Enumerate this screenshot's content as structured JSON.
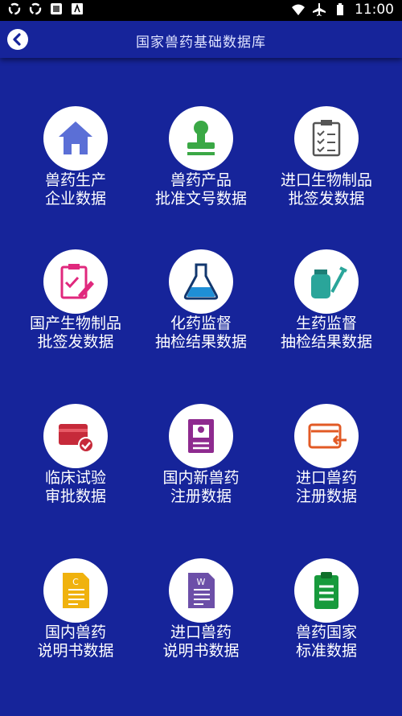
{
  "status_bar": {
    "time": "11:00",
    "left_icons": [
      "sync-icon",
      "sync-icon",
      "app-notification-icon",
      "android-icon"
    ],
    "right_icons": [
      "wifi-icon",
      "airplane-icon",
      "battery-icon"
    ]
  },
  "header": {
    "title": "国家兽药基础数据库",
    "back_icon": "back-arrow-icon"
  },
  "tiles": [
    {
      "label": "兽药生产\n企业数据",
      "icon": "house-icon",
      "color": "#5b6fd6"
    },
    {
      "label": "兽药产品\n批准文号数据",
      "icon": "stamp-icon",
      "color": "#3aa845"
    },
    {
      "label": "进口生物制品\n批签发数据",
      "icon": "clipboard-checklist-icon",
      "color": "#555555"
    },
    {
      "label": "国产生物制品\n批签发数据",
      "icon": "clipboard-pen-icon",
      "color": "#e0287d"
    },
    {
      "label": "化药监督\n抽检结果数据",
      "icon": "flask-icon",
      "color": "#1f8fd6"
    },
    {
      "label": "生药监督\n抽检结果数据",
      "icon": "vial-syringe-icon",
      "color": "#2aa59a"
    },
    {
      "label": "临床试验\n审批数据",
      "icon": "card-check-icon",
      "color": "#c62a3a"
    },
    {
      "label": "国内新兽药\n注册数据",
      "icon": "id-card-icon",
      "color": "#8e2a8f"
    },
    {
      "label": "进口兽药\n注册数据",
      "icon": "card-arrow-icon",
      "color": "#e25a25"
    },
    {
      "label": "国内兽药\n说明书数据",
      "icon": "document-c-icon",
      "color": "#f0b20e"
    },
    {
      "label": "进口兽药\n说明书数据",
      "icon": "document-w-icon",
      "color": "#6c4fa8"
    },
    {
      "label": "兽药国家\n标准数据",
      "icon": "clipboard-list-icon",
      "color": "#179a3c"
    }
  ]
}
